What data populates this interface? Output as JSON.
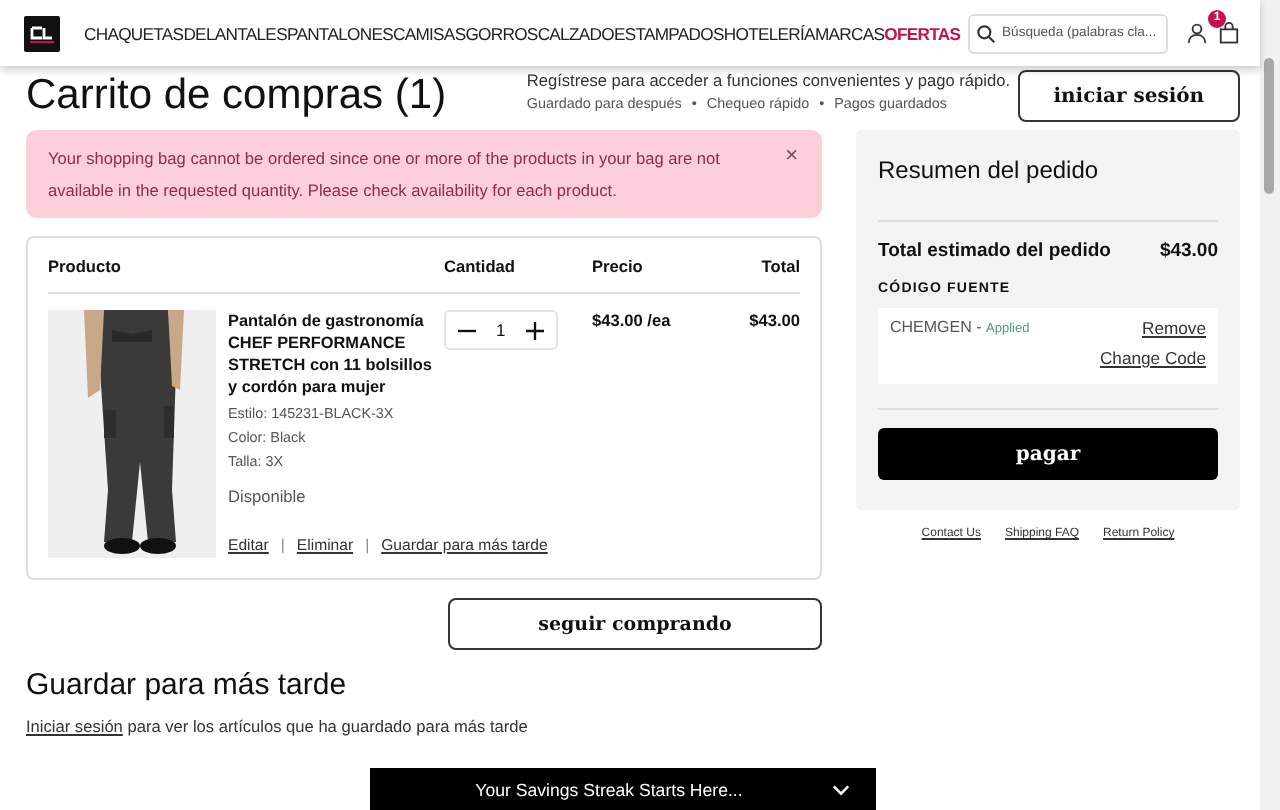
{
  "header": {
    "nav": [
      {
        "label": "CHAQUETAS",
        "color": "#222222"
      },
      {
        "label": "DELANTALES",
        "color": "#222222"
      },
      {
        "label": "PANTALONES",
        "color": "#222222"
      },
      {
        "label": "CAMISAS",
        "color": "#222222"
      },
      {
        "label": "GORROS",
        "color": "#222222"
      },
      {
        "label": "CALZADO",
        "color": "#222222"
      },
      {
        "label": "ESTAMPADOS",
        "color": "#222222"
      },
      {
        "label": "HOTELERÍA",
        "color": "#222222"
      },
      {
        "label": "MARCAS",
        "color": "#222222"
      },
      {
        "label": "OFERTAS",
        "color": "#c8104e"
      }
    ],
    "search": {
      "placeholder": "Búsqueda (palabras cla..."
    },
    "cart_count": "1"
  },
  "page_title": "Carrito de compras (1)",
  "signin_prompt": {
    "text": "Regístrese para acceder a funciones convenientes y pago rápido.",
    "benefits": [
      "Guardado para después",
      "Chequeo rápido",
      "Pagos guardados"
    ],
    "benefit_separator": "•",
    "button": "iniciar sesión"
  },
  "alert": {
    "message": "Your shopping bag cannot be ordered since one or more of the products in your bag are not available in the requested quantity. Please check availability for each product.",
    "close": "×"
  },
  "cart": {
    "columns": [
      "Producto",
      "Cantidad",
      "Precio",
      "Total"
    ],
    "items": [
      {
        "name": "Pantalón de gastronomía CHEF PERFORMANCE STRETCH con 11 bolsillos y cordón para mujer",
        "style": "Estilo: 145231-BLACK-3X",
        "color_label": "Color:  Black",
        "size": "Talla:  3X",
        "availability": "Disponible",
        "quantity": "1",
        "price": "$43.00 /ea",
        "total": "$43.00",
        "actions": [
          "Editar",
          "Eliminar",
          "Guardar para más tarde"
        ],
        "action_separator": "|"
      }
    ]
  },
  "summary": {
    "title": "Resumen del pedido",
    "total_label": "Total estimado del pedido",
    "total_value": "$43.00",
    "code_label": "CÓDIGO FUENTE",
    "code": "CHEMGEN",
    "code_separator": "-",
    "code_status": "Applied",
    "remove": "Remove",
    "change_code": "Change Code",
    "checkout": "pagar",
    "links": [
      "Contact Us",
      "Shipping FAQ",
      "Return Policy"
    ]
  },
  "continue_button": "seguir comprando",
  "saved": {
    "heading": "Guardar para más tarde",
    "link": "Iniciar sesión",
    "text": " para ver los artículos que ha guardado para más tarde"
  },
  "promo_bar": {
    "text": "Your Savings Streak Starts Here..."
  }
}
